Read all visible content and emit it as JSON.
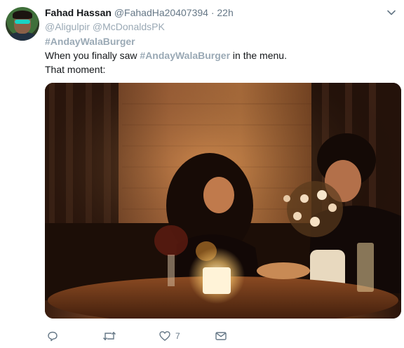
{
  "tweet": {
    "author_name": "Fahad Hassan",
    "author_handle": "@FahadHa20407394",
    "separator": "·",
    "timestamp": "22h",
    "reply_mentions": [
      "@Aligulpir",
      "@McDonaldsPK"
    ],
    "hashtag_line": "#AndayWalaBurger",
    "text_part1": "When you finally saw ",
    "text_hashtag": "#AndayWalaBurger",
    "text_part2": " in the menu.",
    "text_line2": "That moment:"
  },
  "actions": {
    "reply_icon": "reply-icon",
    "retweet_icon": "retweet-icon",
    "like_icon": "heart-icon",
    "like_count": "7",
    "dm_icon": "envelope-icon"
  },
  "colors": {
    "link": "#9aa9b5",
    "text": "#14171a",
    "muted": "#657786"
  }
}
